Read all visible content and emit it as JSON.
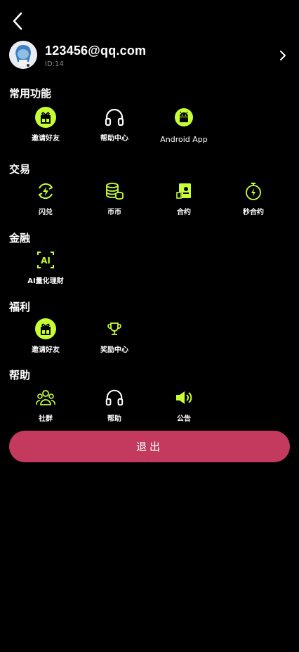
{
  "profile": {
    "email": "123456@qq.com",
    "id": "ID:14"
  },
  "sections": {
    "common": {
      "title": "常用功能",
      "items": [
        "邀请好友",
        "帮助中心",
        "Android App"
      ]
    },
    "trade": {
      "title": "交易",
      "items": [
        "闪兑",
        "币币",
        "合约",
        "秒合约"
      ]
    },
    "finance": {
      "title": "金融",
      "items": [
        "AI量化理财"
      ]
    },
    "welfare": {
      "title": "福利",
      "items": [
        "邀请好友",
        "奖励中心"
      ]
    },
    "help": {
      "title": "帮助",
      "items": [
        "社群",
        "帮助",
        "公告"
      ]
    }
  },
  "logout_label": "退出",
  "colors": {
    "accent": "#c6ff33",
    "logout": "#c33a5e",
    "background": "#000000"
  }
}
